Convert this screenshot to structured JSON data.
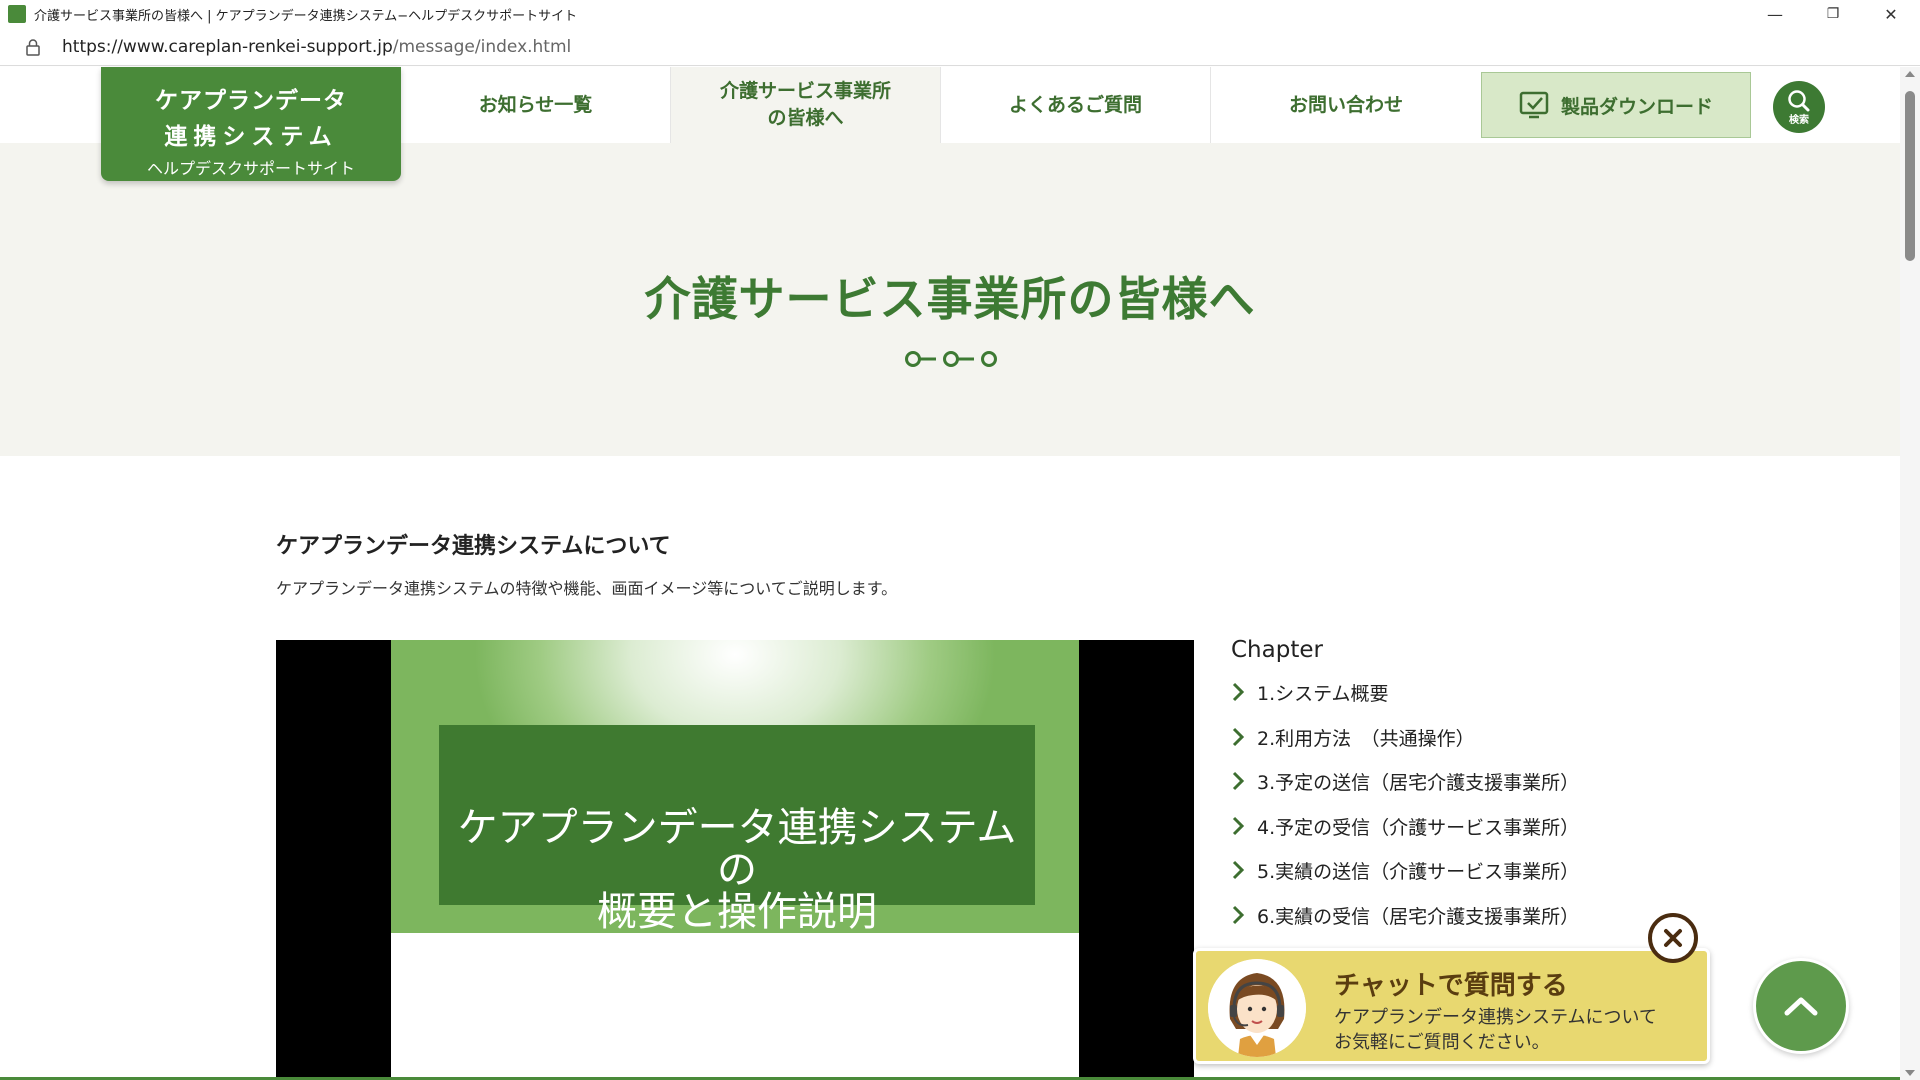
{
  "window": {
    "title": "介護サービス事業所の皆様へ | ケアプランデータ連携システム−ヘルプデスクサポートサイト",
    "minimize": "—",
    "restore": "❐",
    "close": "✕"
  },
  "address_bar": {
    "url_host": "https://www.careplan-renkei-support.jp",
    "url_path": "/message/index.html"
  },
  "logo": {
    "line1": "ケアプランデータ",
    "line2": "連携システム",
    "line3": "ヘルプデスクサポートサイト"
  },
  "nav": {
    "items": [
      {
        "label": "お知らせ一覧"
      },
      {
        "label_line1": "介護サービス事業所",
        "label_line2": "の皆様へ"
      },
      {
        "label": "よくあるご質問"
      },
      {
        "label": "お問い合わせ"
      }
    ],
    "download_label": "製品ダウンロード",
    "search_label": "検索"
  },
  "hero": {
    "title": "介護サービス事業所の皆様へ"
  },
  "content": {
    "section_title": "ケアプランデータ連携システムについて",
    "section_desc": "ケアプランデータ連携システムの特徴や機能、画面イメージ等についてご説明します。"
  },
  "video": {
    "slide_line1": "ケアプランデータ連携システムの",
    "slide_line2": "概要と操作説明"
  },
  "chapter": {
    "heading": "Chapter",
    "items": [
      "1.システム概要",
      "2.利用方法　（共通操作）",
      "3.予定の送信（居宅介護支援事業所）",
      "4.予定の受信（介護サービス事業所）",
      "5.実績の送信（介護サービス事業所）",
      "6.実績の受信（居宅介護支援事業所）"
    ]
  },
  "chat": {
    "title": "チャットで質問する",
    "line1": "ケアプランデータ連携システムについて",
    "line2": "お気軽にご質問ください。"
  },
  "colors": {
    "brand_green": "#4a8a3a",
    "dark_green": "#3d7a33",
    "hero_bg": "#f4f4ef",
    "download_bg": "#d8e8c8",
    "chat_bg": "#e8d870"
  }
}
